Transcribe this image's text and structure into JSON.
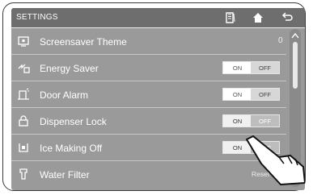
{
  "header": {
    "title": "SETTINGS"
  },
  "icons": {
    "book": "book-icon",
    "home": "home-icon",
    "back": "back-arrow-icon"
  },
  "settings": [
    {
      "label": "Screensaver Theme",
      "icon": "screensaver-icon",
      "value": "0"
    },
    {
      "label": "Energy Saver",
      "icon": "energy-saver-icon",
      "toggle": {
        "on": "ON",
        "off": "OFF",
        "selected": "OFF"
      }
    },
    {
      "label": "Door Alarm",
      "icon": "door-alarm-icon",
      "toggle": {
        "on": "ON",
        "off": "OFF",
        "selected": "OFF"
      }
    },
    {
      "label": "Dispenser Lock",
      "icon": "lock-icon",
      "toggle": {
        "on": "ON",
        "off": "OFF",
        "selected": "ON"
      }
    },
    {
      "label": "Ice Making Off",
      "icon": "ice-icon",
      "toggle": {
        "on": "ON",
        "off": "OFF",
        "selected": "ON"
      }
    },
    {
      "label": "Water Filter",
      "icon": "water-filter-icon",
      "action": "Reset"
    }
  ]
}
